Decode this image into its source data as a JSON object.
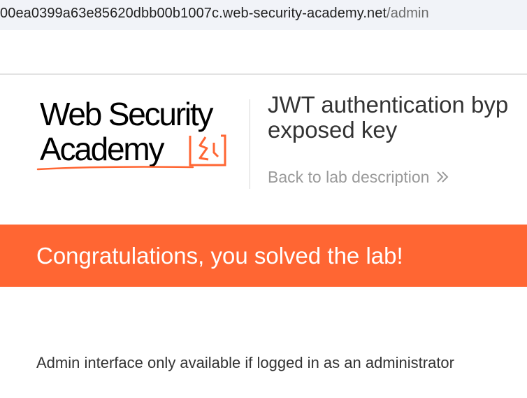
{
  "browser": {
    "url_host": "00ea0399a63e85620dbb00b1007c.web-security-academy.net",
    "url_path": "/admin"
  },
  "header": {
    "logo": {
      "line1": "Web Security",
      "line2": "Academy",
      "accent_color": "#ff6633"
    },
    "lab_title_line1": "JWT authentication byp",
    "lab_title_line2": "exposed key",
    "back_link": "Back to lab description"
  },
  "banner": {
    "text": "Congratulations, you solved the lab!",
    "color": "#ff6633"
  },
  "main": {
    "message": "Admin interface only available if logged in as an administrator"
  }
}
